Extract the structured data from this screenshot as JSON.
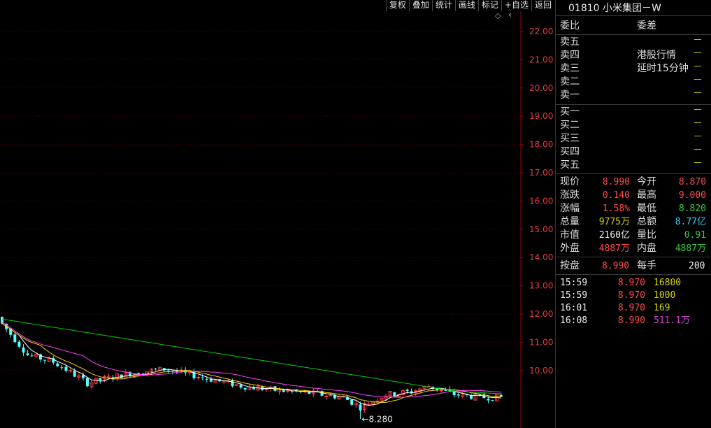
{
  "toolbar": {
    "buttons": [
      "复权",
      "叠加",
      "统计",
      "画线",
      "标记",
      "+自选",
      "返回"
    ]
  },
  "chart_data": {
    "type": "candlestick",
    "y_axis_ticks": [
      "22.00",
      "21.00",
      "20.00",
      "19.00",
      "18.00",
      "17.00",
      "16.00",
      "15.00",
      "14.00",
      "13.00",
      "12.00",
      "11.00",
      "10.00"
    ],
    "ylim": [
      9.0,
      22.5
    ],
    "low_annotation": "8.280",
    "colors": {
      "up": "#ff3c3c",
      "down": "#54ffff",
      "ma5": "#ffffff",
      "ma10": "#ffd000",
      "ma20": "#ff40ff",
      "ma60": "#00d000",
      "grid": "#5a0000",
      "axis": "#a00000"
    }
  },
  "panel": {
    "title": "01810 小米集团－W",
    "weibi_label": "委比",
    "weicha_label": "委差",
    "sell_labels": [
      "卖五",
      "卖四",
      "卖三",
      "卖二",
      "卖一"
    ],
    "buy_labels": [
      "买一",
      "买二",
      "买三",
      "买四",
      "买五"
    ],
    "dash": "－",
    "hk_note1": "港股行情",
    "hk_note2": "延时15分钟",
    "quote": [
      {
        "l1": "现价",
        "v1": "8.990",
        "c1": "red",
        "l2": "今开",
        "v2": "8.870",
        "c2": "red"
      },
      {
        "l1": "涨跌",
        "v1": "0.140",
        "c1": "red",
        "l2": "最高",
        "v2": "9.000",
        "c2": "red"
      },
      {
        "l1": "涨幅",
        "v1": "1.58%",
        "c1": "red",
        "l2": "最低",
        "v2": "8.820",
        "c2": "green"
      },
      {
        "l1": "总量",
        "v1": "9775万",
        "c1": "yellow",
        "l2": "总额",
        "v2": "8.77亿",
        "c2": "cyan"
      },
      {
        "l1": "市值",
        "v1": "2160亿",
        "c1": "white",
        "l2": "量比",
        "v2": "0.91",
        "c2": "green"
      },
      {
        "l1": "外盘",
        "v1": "4887万",
        "c1": "red",
        "l2": "内盘",
        "v2": "4887万",
        "c2": "green"
      }
    ],
    "anpan": {
      "l1": "按盘",
      "v1": "8.990",
      "l2": "每手",
      "v2": "200"
    },
    "ticks": [
      {
        "time": "15:59",
        "price": "8.970",
        "vol": "16800",
        "vc": "yellow"
      },
      {
        "time": "15:59",
        "price": "8.970",
        "vol": "1000",
        "vc": "yellow"
      },
      {
        "time": "16:01",
        "price": "8.970",
        "vol": "169",
        "vc": "yellow"
      },
      {
        "time": "16:08",
        "price": "8.990",
        "vol": "511.1万",
        "vc": "magenta"
      }
    ]
  }
}
